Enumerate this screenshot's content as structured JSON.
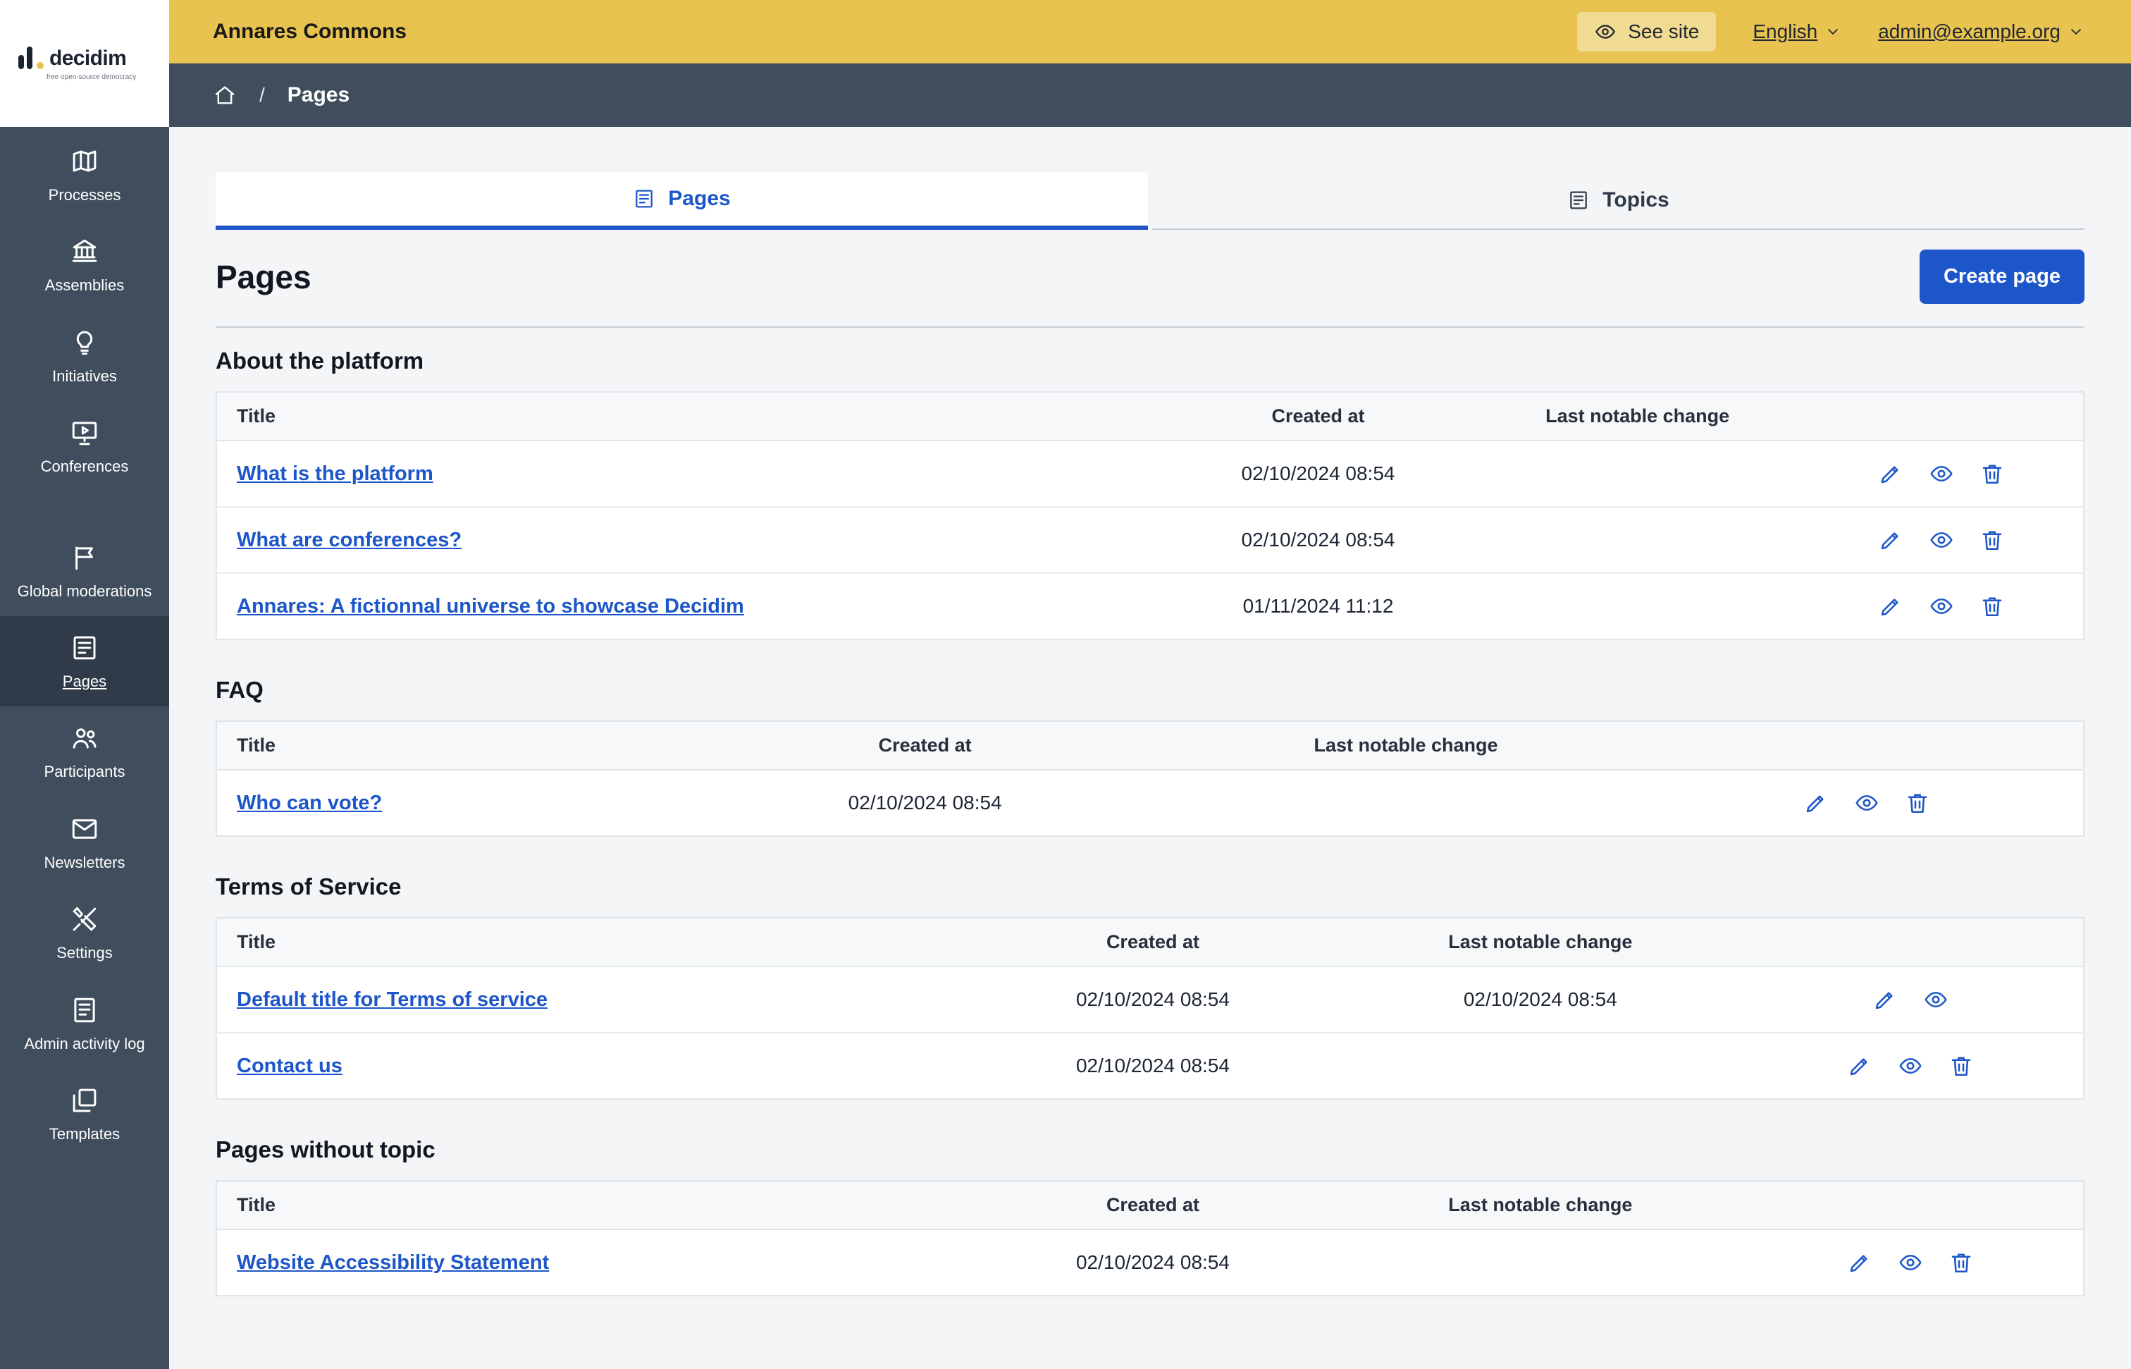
{
  "colors": {
    "topbar": "#e8c350",
    "sidebar": "#3f4d5d",
    "sidebar_active": "#2f3b49",
    "accent": "#1d56c8",
    "page_bg": "#f4f5f7"
  },
  "logo": {
    "brand": "decidim",
    "tagline": "free open-source democracy"
  },
  "topbar": {
    "title": "Annares Commons",
    "see_site": "See site",
    "language": "English",
    "account": "admin@example.org"
  },
  "breadcrumb": {
    "separator": "/",
    "page": "Pages"
  },
  "sidebar": {
    "items": [
      {
        "label": "Processes",
        "icon": "map-icon"
      },
      {
        "label": "Assemblies",
        "icon": "bank-icon"
      },
      {
        "label": "Initiatives",
        "icon": "lightbulb-icon"
      },
      {
        "label": "Conferences",
        "icon": "presentation-icon"
      },
      {
        "label": "Global moderations",
        "icon": "flag-icon",
        "divider_before": true
      },
      {
        "label": "Pages",
        "icon": "pages-icon",
        "active": true
      },
      {
        "label": "Participants",
        "icon": "people-icon"
      },
      {
        "label": "Newsletters",
        "icon": "mail-plus-icon"
      },
      {
        "label": "Settings",
        "icon": "tools-icon"
      },
      {
        "label": "Admin activity log",
        "icon": "log-icon"
      },
      {
        "label": "Templates",
        "icon": "templates-icon"
      }
    ]
  },
  "tabs": {
    "pages": "Pages",
    "topics": "Topics"
  },
  "main": {
    "title": "Pages",
    "create_button": "Create page"
  },
  "columns": {
    "title": "Title",
    "created_at": "Created at",
    "last_change": "Last notable change"
  },
  "sections": [
    {
      "heading": "About the platform",
      "rows": [
        {
          "title": "What is the platform",
          "created_at": "02/10/2024 08:54",
          "last_change": "",
          "actions": [
            "edit",
            "preview",
            "delete"
          ]
        },
        {
          "title": "What are conferences?",
          "created_at": "02/10/2024 08:54",
          "last_change": "",
          "actions": [
            "edit",
            "preview",
            "delete"
          ]
        },
        {
          "title": "Annares: A fictionnal universe to showcase Decidim",
          "created_at": "01/11/2024 11:12",
          "last_change": "",
          "actions": [
            "edit",
            "preview",
            "delete"
          ]
        }
      ]
    },
    {
      "heading": "FAQ",
      "rows": [
        {
          "title": "Who can vote?",
          "created_at": "02/10/2024 08:54",
          "last_change": "",
          "actions": [
            "edit",
            "preview",
            "delete"
          ]
        }
      ]
    },
    {
      "heading": "Terms of Service",
      "rows": [
        {
          "title": "Default title for Terms of service",
          "created_at": "02/10/2024 08:54",
          "last_change": "02/10/2024 08:54",
          "actions": [
            "edit",
            "preview"
          ]
        },
        {
          "title": "Contact us",
          "created_at": "02/10/2024 08:54",
          "last_change": "",
          "actions": [
            "edit",
            "preview",
            "delete"
          ]
        }
      ]
    },
    {
      "heading": "Pages without topic",
      "rows": [
        {
          "title": "Website Accessibility Statement",
          "created_at": "02/10/2024 08:54",
          "last_change": "",
          "actions": [
            "edit",
            "preview",
            "delete"
          ]
        }
      ]
    }
  ]
}
